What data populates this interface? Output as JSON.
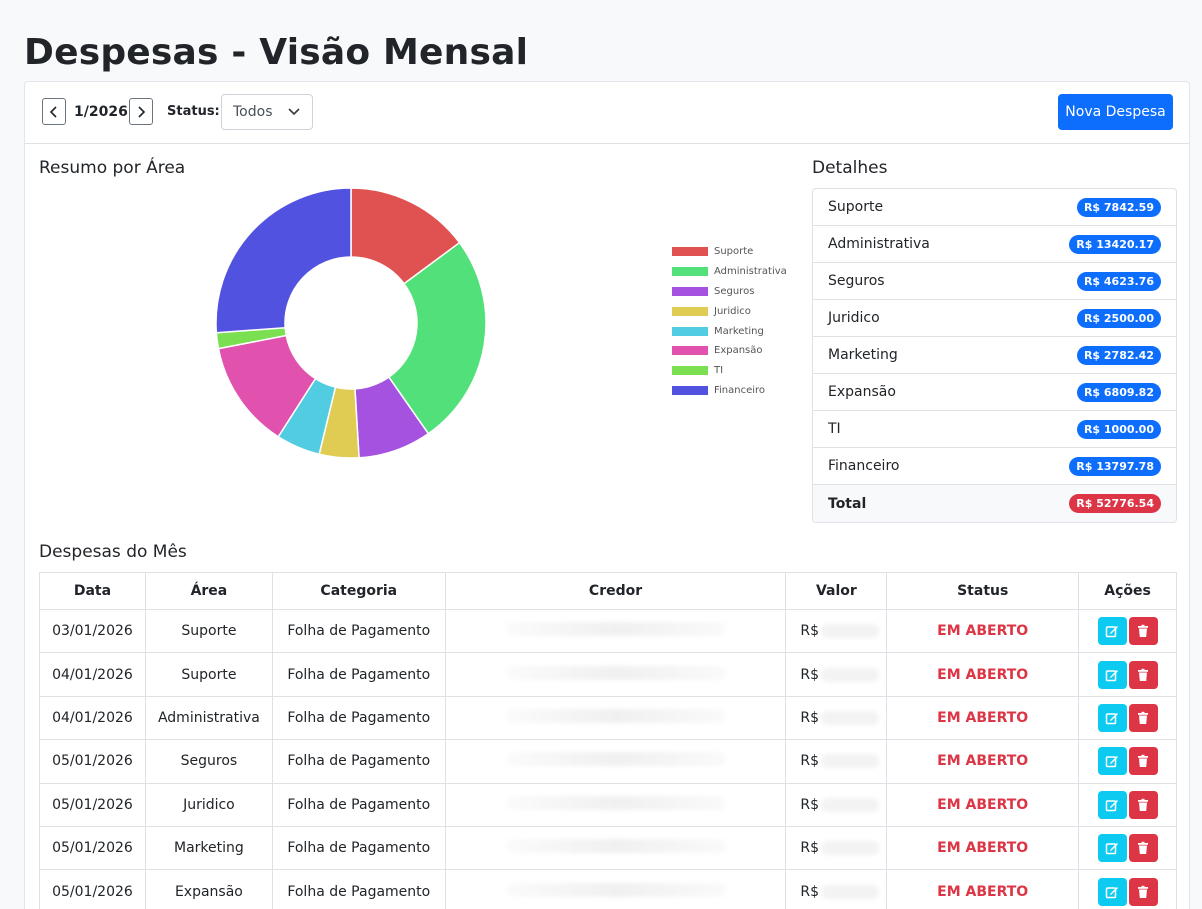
{
  "page": {
    "title": "Despesas - Visão Mensal"
  },
  "toolbar": {
    "month": "1/2026",
    "status_label": "Status:",
    "status_value": "Todos",
    "new_button": "Nova Despesa"
  },
  "summary": {
    "title": "Resumo por Área"
  },
  "details": {
    "title": "Detalhes",
    "rows": [
      {
        "label": "Suporte",
        "value": "R$ 7842.59"
      },
      {
        "label": "Administrativa",
        "value": "R$ 13420.17"
      },
      {
        "label": "Seguros",
        "value": "R$ 4623.76"
      },
      {
        "label": "Juridico",
        "value": "R$ 2500.00"
      },
      {
        "label": "Marketing",
        "value": "R$ 2782.42"
      },
      {
        "label": "Expansão",
        "value": "R$ 6809.82"
      },
      {
        "label": "TI",
        "value": "R$ 1000.00"
      },
      {
        "label": "Financeiro",
        "value": "R$ 13797.78"
      }
    ],
    "total_label": "Total",
    "total_value": "R$ 52776.54"
  },
  "chart_data": {
    "type": "pie",
    "donut": true,
    "categories": [
      "Suporte",
      "Administrativa",
      "Seguros",
      "Juridico",
      "Marketing",
      "Expansão",
      "TI",
      "Financeiro"
    ],
    "values": [
      7842.59,
      13420.17,
      4623.76,
      2500.0,
      2782.42,
      6809.82,
      1000.0,
      13797.78
    ],
    "colors": [
      "#e05252",
      "#52e07a",
      "#a652e0",
      "#e0cc52",
      "#52cce0",
      "#e052ad",
      "#7ae052",
      "#5252e0"
    ],
    "legend_position": "right"
  },
  "expenses": {
    "title": "Despesas do Mês",
    "headers": [
      "Data",
      "Área",
      "Categoria",
      "Credor",
      "Valor",
      "Status",
      "Ações"
    ],
    "currency": "R$",
    "rows": [
      {
        "data": "03/01/2026",
        "area": "Suporte",
        "categoria": "Folha de Pagamento",
        "status": "EM ABERTO"
      },
      {
        "data": "04/01/2026",
        "area": "Suporte",
        "categoria": "Folha de Pagamento",
        "status": "EM ABERTO"
      },
      {
        "data": "04/01/2026",
        "area": "Administrativa",
        "categoria": "Folha de Pagamento",
        "status": "EM ABERTO"
      },
      {
        "data": "05/01/2026",
        "area": "Seguros",
        "categoria": "Folha de Pagamento",
        "status": "EM ABERTO"
      },
      {
        "data": "05/01/2026",
        "area": "Juridico",
        "categoria": "Folha de Pagamento",
        "status": "EM ABERTO"
      },
      {
        "data": "05/01/2026",
        "area": "Marketing",
        "categoria": "Folha de Pagamento",
        "status": "EM ABERTO"
      },
      {
        "data": "05/01/2026",
        "area": "Expansão",
        "categoria": "Folha de Pagamento",
        "status": "EM ABERTO"
      }
    ]
  },
  "icons": {
    "prev": "chevron-left-icon",
    "next": "chevron-right-icon",
    "select": "chevron-down-icon",
    "edit": "edit-icon",
    "delete": "trash-icon"
  }
}
